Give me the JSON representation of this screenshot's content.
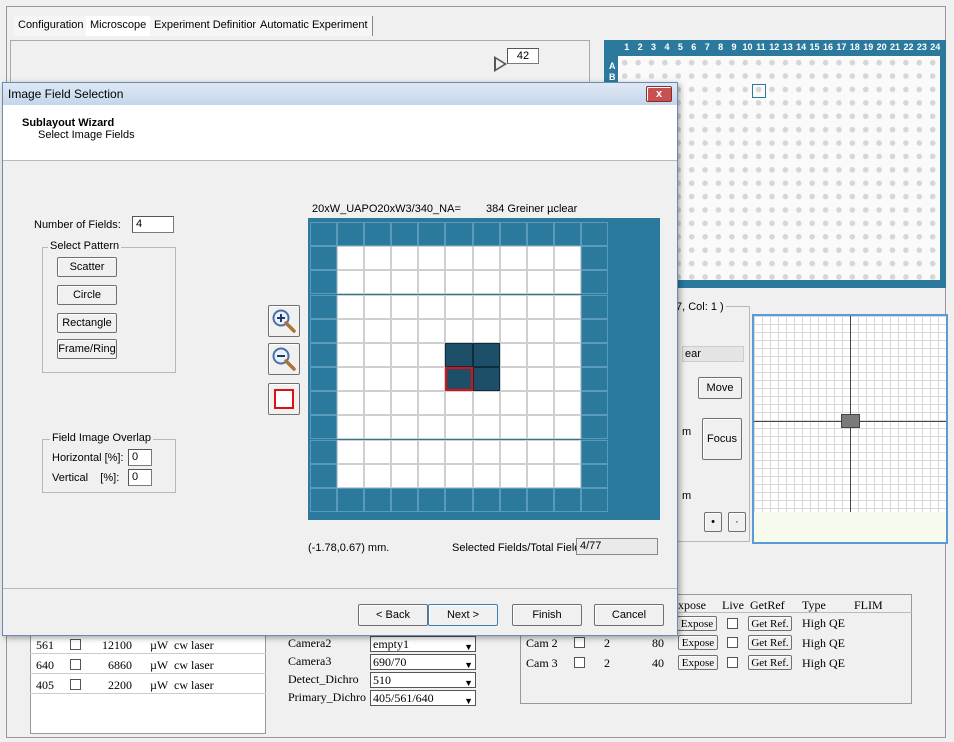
{
  "tabs": [
    "Configuration",
    "Microscope",
    "Experiment Definition",
    "Automatic Experiment"
  ],
  "counter": "42",
  "plate": {
    "columns": [
      "1",
      "2",
      "3",
      "4",
      "5",
      "6",
      "7",
      "8",
      "9",
      "10",
      "11",
      "12",
      "13",
      "14",
      "15",
      "16",
      "17",
      "18",
      "19",
      "20",
      "21",
      "22",
      "23",
      "24"
    ],
    "row_label_a": "A",
    "row_label_b": "B"
  },
  "right_panel": {
    "position_label": "7, Col: 1 )",
    "clear_text": "ear",
    "move_label": "Move",
    "focus_label": "Focus",
    "m_label1": "m",
    "m_label2": "m",
    "dot_btn1": "•",
    "dot_btn2": "·"
  },
  "dialog": {
    "title": "Image Field Selection",
    "wizard_title": "Sublayout Wizard",
    "wizard_subtitle": "Select Image Fields",
    "num_fields_label": "Number of Fields:",
    "num_fields_value": "4",
    "select_pattern_label": "Select Pattern",
    "pattern_buttons": [
      "Scatter",
      "Circle",
      "Rectangle",
      "Frame/Ring"
    ],
    "overlap_label": "Field Image Overlap",
    "horizontal_label": "Horizontal [%]:",
    "horizontal_value": "0",
    "vertical_label": "Vertical    [%]:",
    "vertical_value": "0",
    "objective_label": "20xW_UAPO20xW3/340_NA=",
    "plate_label": "384 Greiner µclear",
    "coord_label": "(-1.78,0.67) mm.",
    "selected_label": "Selected Fields/Total Fields",
    "selected_value": "4/77",
    "back_label": "< Back",
    "next_label": "Next >",
    "finish_label": "Finish",
    "cancel_label": "Cancel",
    "close_label": "x",
    "grid": {
      "cols": 11,
      "rows": 12,
      "selected": [
        [
          5,
          5
        ],
        [
          6,
          5
        ],
        [
          5,
          6
        ],
        [
          6,
          6
        ]
      ],
      "highlighted": [
        5,
        6
      ]
    },
    "colors": {
      "well_blue": "#2b7a9e",
      "cell_selected": "#1d4f68",
      "highlight_border": "#d11"
    }
  },
  "lasers": [
    {
      "wavelength": "561",
      "power": "12100",
      "unit": "µW",
      "type": "cw laser"
    },
    {
      "wavelength": "640",
      "power": "6860",
      "unit": "µW",
      "type": "cw laser"
    },
    {
      "wavelength": "405",
      "power": "2200",
      "unit": "µW",
      "type": "cw laser"
    }
  ],
  "filters": [
    {
      "label": "Camera2",
      "value": "empty1"
    },
    {
      "label": "Camera3",
      "value": "690/70"
    },
    {
      "label": "Detect_Dichro",
      "value": "510"
    },
    {
      "label": "Primary_Dichro",
      "value": "405/561/640"
    }
  ],
  "camera_table": {
    "headers": [
      "xpose",
      "Live",
      "GetRef",
      "Type",
      "FLIM"
    ],
    "first_row": {
      "expose": "Expose",
      "getref": "Get Ref.",
      "type": "High QE"
    },
    "rows": [
      {
        "cam": "Cam 2",
        "n": "2",
        "val": "80",
        "expose": "Expose",
        "getref": "Get Ref.",
        "type": "High QE"
      },
      {
        "cam": "Cam 3",
        "n": "2",
        "val": "40",
        "expose": "Expose",
        "getref": "Get Ref.",
        "type": "High QE"
      }
    ]
  }
}
